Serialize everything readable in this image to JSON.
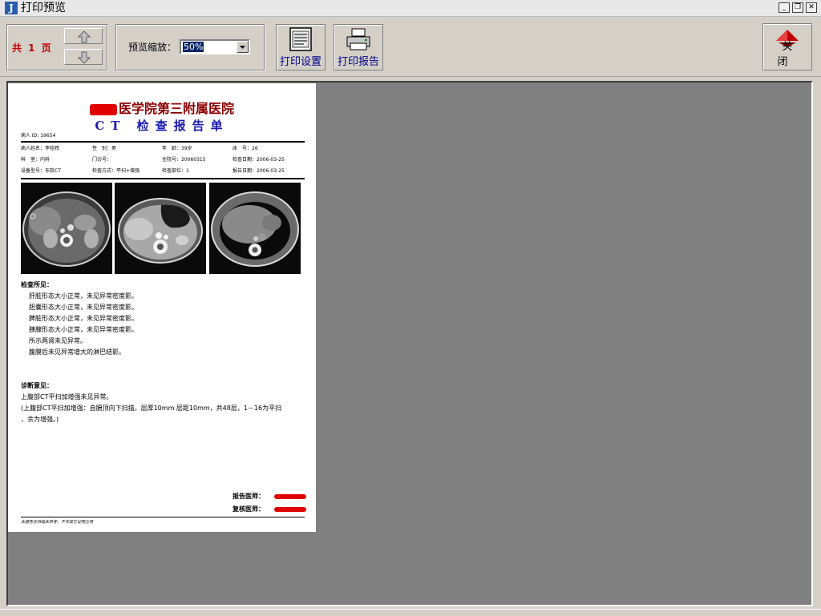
{
  "window": {
    "title": "打印预览",
    "icon": "app-logo-icon"
  },
  "toolbar": {
    "page_count": "共 1 页",
    "zoom_label": "预览缩放：",
    "zoom_value": "50%",
    "print_settings_label": "打印设置",
    "print_report_label": "打印报告",
    "close_label": "关闭"
  },
  "report": {
    "hospital_suffix": "医学院第三附属医院",
    "title": "CT 检查报告单",
    "patient_id": "病人 ID: 19654",
    "info_rows": [
      [
        "病人姓名：李桂辉",
        "性　别：男",
        "年　龄：39岁",
        "床　号：26"
      ],
      [
        "科　室：内科",
        "门诊号：",
        "住院号：20060315",
        "检查日期：2006-03-25"
      ],
      [
        "设备型号：东软CT",
        "检查方式：平扫+增强",
        "检查部位：1",
        "报告日期：2006-03-25"
      ]
    ],
    "findings_title": "检查所见：",
    "findings": [
      "肝脏形态大小正常，未见异常密度影。",
      "胆囊形态大小正常，未见异常密度影。",
      "脾脏形态大小正常，未见异常密度影。",
      "胰腺形态大小正常，未见异常密度影。",
      "所示两肾未见异常。",
      "腹膜后未见异常增大的淋巴结影。"
    ],
    "diagnosis_title": "诊断意见：",
    "diagnosis": [
      "上腹部CT平扫加增强未见异常。",
      "(上腹部CT平扫加增强：自膈顶向下扫描，层厚10mm 层距10mm，共48层，1－16为平扫",
      "，余为增强。)"
    ],
    "report_doctor_label": "报告医师：",
    "review_doctor_label": "复核医师：",
    "footer_note": "本报告仅供临床参考，不作其它证明之用"
  }
}
